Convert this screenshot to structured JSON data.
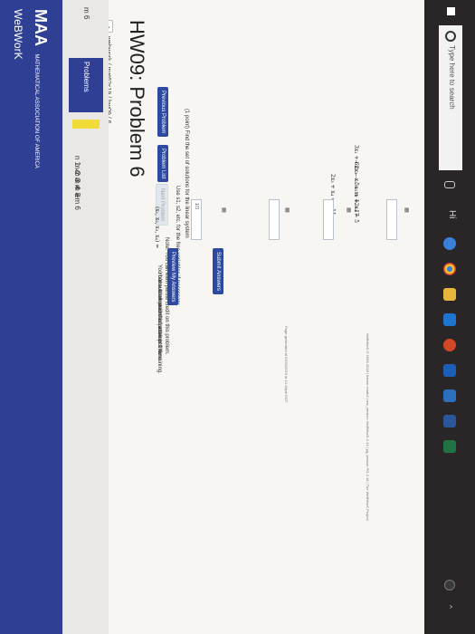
{
  "site": {
    "logo_top": "MAA",
    "logo_bottom": "MATHEMATICAL ASSOCIATION OF AMERICA",
    "app_name": "WeBWorK"
  },
  "breadcrumb": "webwork / mat62s19 / hw09 / 6",
  "page_title": "HW09: Problem 6",
  "nav": {
    "previous": "Previous Problem",
    "list": "Problem List",
    "next": "Next Problem"
  },
  "sidebar": {
    "heading": "Problems",
    "items": [
      "m 6",
      "n 1 ✓",
      "m 2 ✓",
      "m 3 ✓",
      "m 4 ✓",
      "m 5",
      "em 6"
    ]
  },
  "problem": {
    "prompt": "(1 point) Find the set of solutions for the linear system",
    "equations": [
      "3x₁ + 6x₂ − x₃ − x₄ = −17",
      "− 2x₂ − 5x₃ + 12x₄ = 5",
      "2x₃ + x₄ = −11"
    ],
    "free_var_note": "Use s1, s2, etc. for the free variables if necessary.",
    "answer_label": "(x₁, x₂, x₃, x₄) =",
    "answer_value": "1/3",
    "partial_credit": "Note: You can earn partial credit on this problem.",
    "preview_button": "Preview My Answers",
    "submit_button": "Submit Answers",
    "attempt_lines": [
      "You have attempted this problem 1 time.",
      "Your overall recorded score is 0%.",
      "You have unlimited attempts remaining."
    ],
    "footer_lines": [
      "Page generated at 03/31/2019 at 12:18pm EDT",
      "WeBWorK © 1996-2018 | theme: math4 | ww_version: WeBWorK-2.14 | pg_version PG-2.14 | The WeBWorK Project"
    ]
  },
  "taskbar": {
    "search_placeholder": "Type here to search",
    "keyboard_label": "Hi",
    "icon_names": [
      "windows-icon",
      "search-icon",
      "microphone-icon",
      "task-view-icon",
      "edge-icon",
      "folder-icon",
      "chrome-icon",
      "store-icon",
      "powerpoint-icon",
      "photos-icon",
      "mail-icon",
      "word-icon",
      "excel-icon",
      "settings-icon"
    ]
  },
  "colors": {
    "brand": "#2f3f93",
    "button": "#2d4aa0",
    "highlight": "#f2dc3a",
    "taskbar": "#2a2627"
  }
}
